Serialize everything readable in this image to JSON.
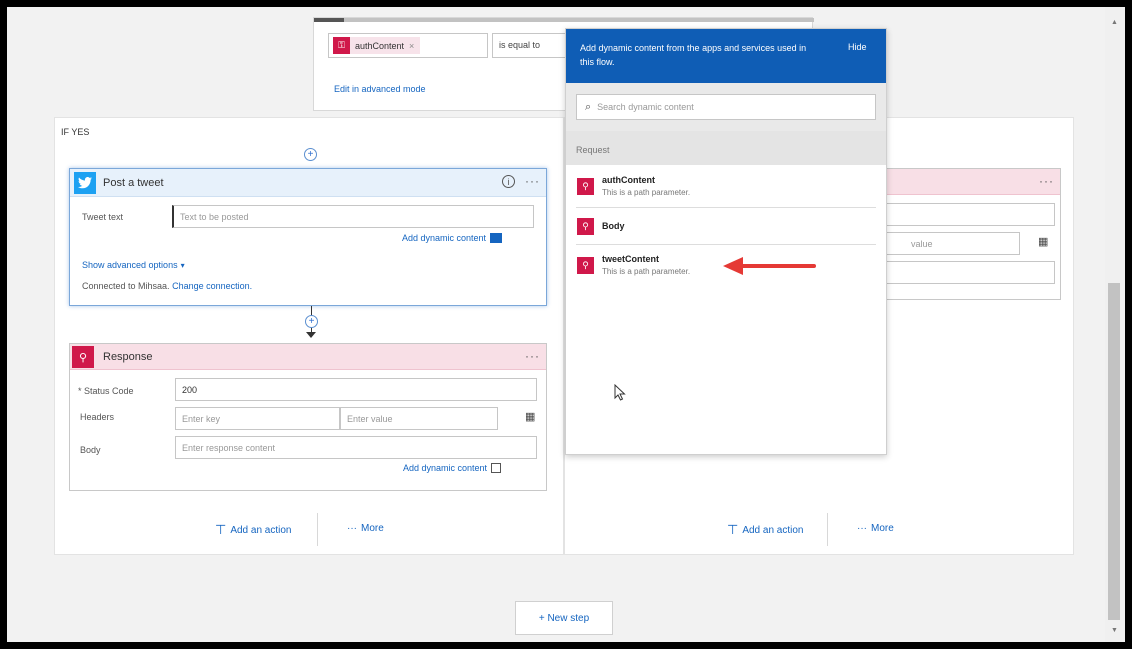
{
  "condition": {
    "token_label": "authContent",
    "token_close": "×",
    "operator": "is equal to",
    "advanced_link": "Edit in advanced mode"
  },
  "if_yes": {
    "label": "IF YES",
    "tweet_card": {
      "title": "Post a tweet",
      "tweet_text_label": "Tweet text",
      "tweet_text_placeholder": "Text to be posted",
      "add_dynamic": "Add dynamic content",
      "advanced_options": "Show advanced options",
      "connected_text": "Connected to Mihsaa.",
      "change_connection": "Change connection."
    },
    "response_card": {
      "title": "Response",
      "status_code_label": "* Status Code",
      "status_code_value": "200",
      "headers_label": "Headers",
      "key_placeholder": "Enter key",
      "value_placeholder": "Enter value",
      "body_label": "Body",
      "body_placeholder": "Enter response content",
      "add_dynamic": "Add dynamic content"
    },
    "add_action": "Add an action",
    "more": "More"
  },
  "if_no": {
    "value_placeholder": "value",
    "add_action": "Add an action",
    "more": "More"
  },
  "dynamic_panel": {
    "header_text": "Add dynamic content from the apps and services used in this flow.",
    "hide": "Hide",
    "search_placeholder": "Search dynamic content",
    "section_label": "Request",
    "items": [
      {
        "name": "authContent",
        "desc": "This is a path parameter."
      },
      {
        "name": "Body",
        "desc": ""
      },
      {
        "name": "tweetContent",
        "desc": "This is a path parameter."
      }
    ]
  },
  "new_step": "+ New step",
  "colors": {
    "accent_blue": "#0f5db5",
    "response_red": "#d0184a",
    "twitter_blue": "#1da1f2",
    "arrow_red": "#e53935"
  }
}
